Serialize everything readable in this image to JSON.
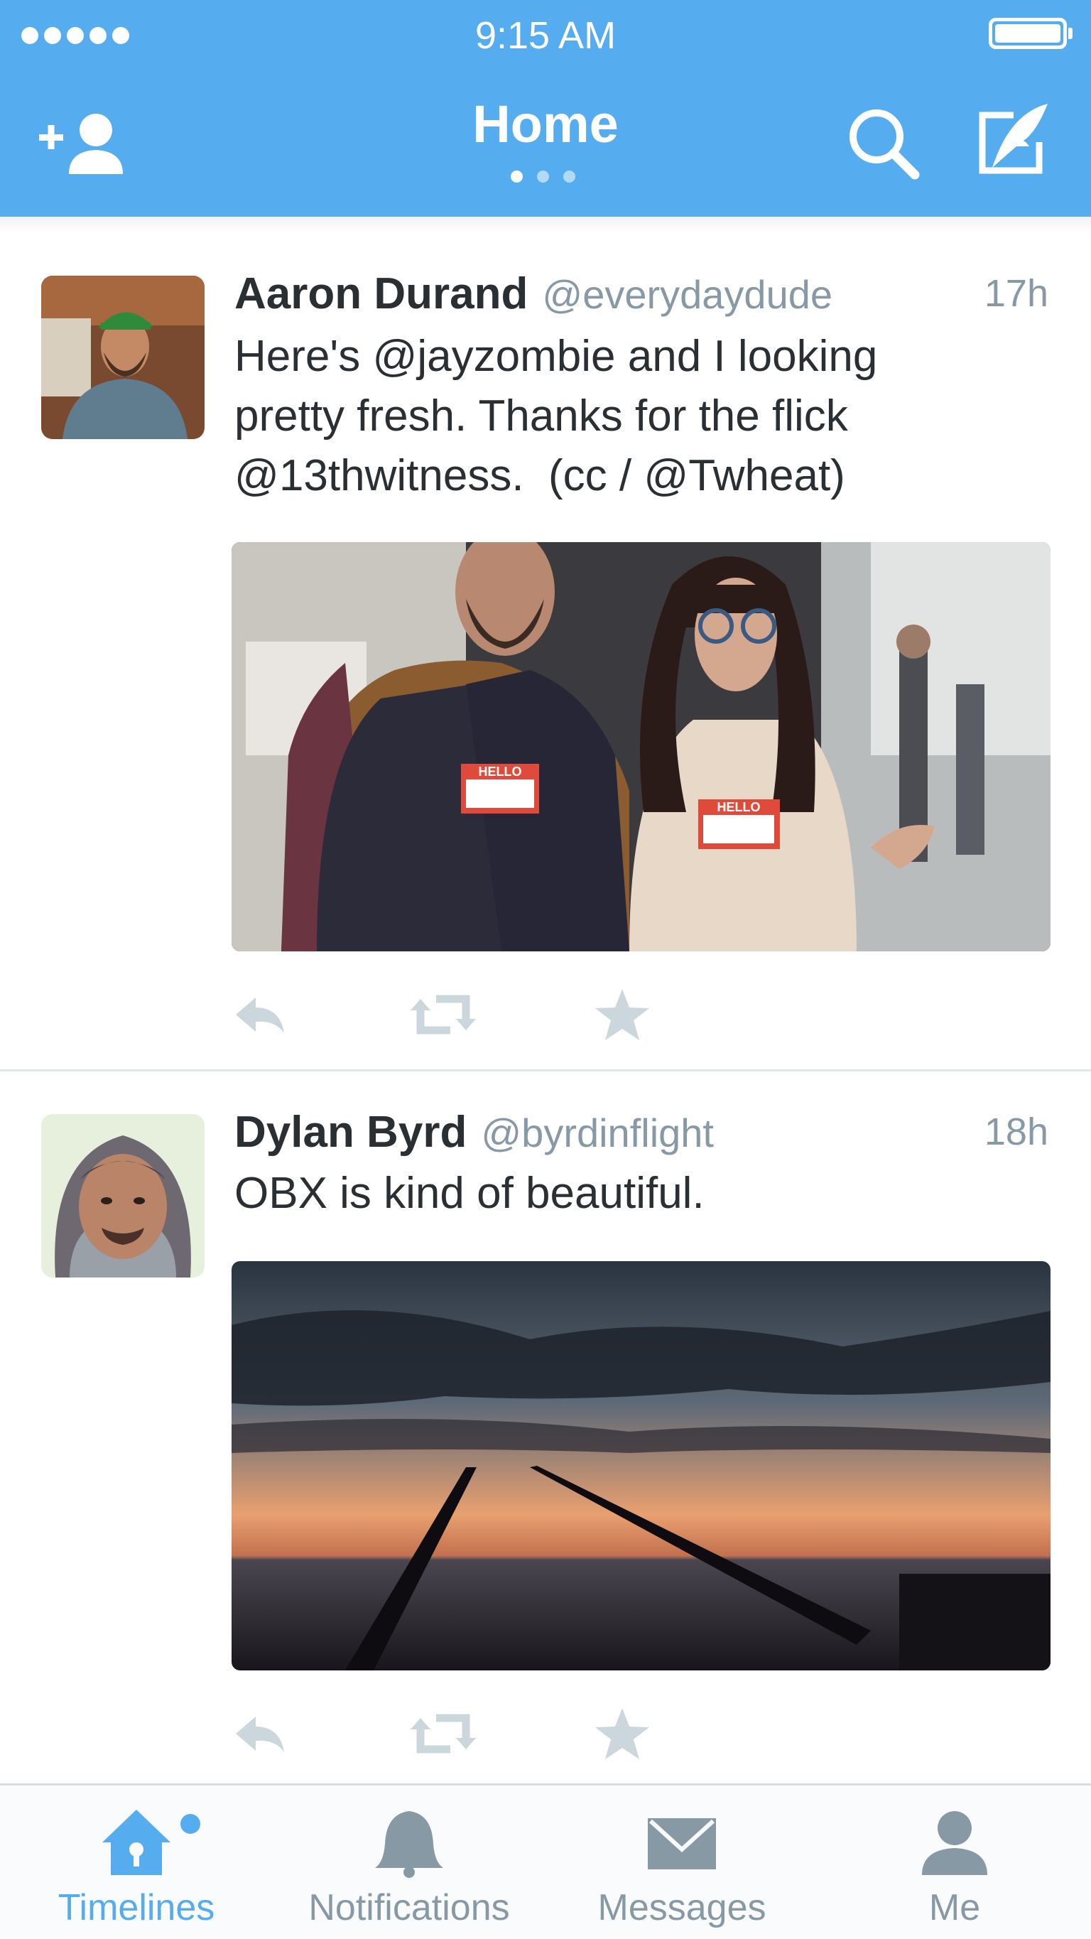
{
  "status_bar": {
    "time": "9:15 AM",
    "signal_icon": "signal-dots-icon",
    "battery_icon": "battery-full-icon"
  },
  "header": {
    "title": "Home",
    "add_user_icon": "add-user-icon",
    "search_icon": "search-icon",
    "compose_icon": "compose-icon",
    "page_count": 3,
    "active_page": 1,
    "background": "#55acee"
  },
  "tweets": [
    {
      "name": "Aaron Durand",
      "handle": "@everydaydude",
      "time": "17h",
      "text": "Here's @jayzombie and I looking\npretty fresh. Thanks for the flick\n@13thwitness.  (cc / @Twheat)",
      "has_media": true,
      "media_badges": [
        "HELLO",
        "HELLO"
      ]
    },
    {
      "name": "Dylan Byrd",
      "handle": "@byrdinflight",
      "time": "18h",
      "text": "OBX is kind of beautiful.",
      "has_media": true
    }
  ],
  "tweet_actions": [
    {
      "name": "reply",
      "icon": "reply-icon"
    },
    {
      "name": "retweet",
      "icon": "retweet-icon"
    },
    {
      "name": "favorite",
      "icon": "star-icon"
    }
  ],
  "tabbar": {
    "tabs": [
      {
        "label": "Timelines",
        "icon": "home-icon",
        "active": true,
        "has_dot": true
      },
      {
        "label": "Notifications",
        "icon": "bell-icon",
        "active": false
      },
      {
        "label": "Messages",
        "icon": "envelope-icon",
        "active": false
      },
      {
        "label": "Me",
        "icon": "person-icon",
        "active": false
      }
    ]
  },
  "colors": {
    "accent": "#55acee",
    "text": "#292f33",
    "muted": "#8899a6",
    "icon_inactive": "#ccd6dd"
  }
}
